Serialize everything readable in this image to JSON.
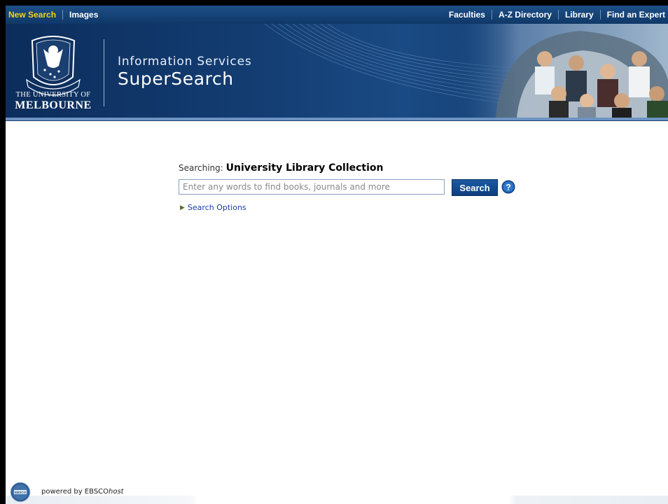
{
  "topnav": {
    "left_items": [
      {
        "label": "New Search",
        "active": true
      },
      {
        "label": "Images",
        "active": false
      }
    ],
    "right_items": [
      {
        "label": "Faculties"
      },
      {
        "label": "A-Z Directory"
      },
      {
        "label": "Library"
      },
      {
        "label": "Find an Expert"
      }
    ]
  },
  "banner": {
    "university_line1": "THE UNIVERSITY OF",
    "university_line2": "MELBOURNE",
    "service_line1": "Information Services",
    "service_line2": "SuperSearch"
  },
  "search": {
    "searching_prefix": "Searching:",
    "collection": "University Library Collection",
    "placeholder": "Enter any words to find books, journals and more",
    "button_label": "Search",
    "options_label": "Search Options"
  },
  "footer": {
    "powered_prefix": "powered by EBSCO",
    "powered_suffix": "host"
  },
  "colors": {
    "nav_bg": "#14457c",
    "nav_active": "#f5d50a",
    "banner_bg": "#0c2d5b",
    "button_bg": "#164f95",
    "link": "#1a3fa6"
  }
}
